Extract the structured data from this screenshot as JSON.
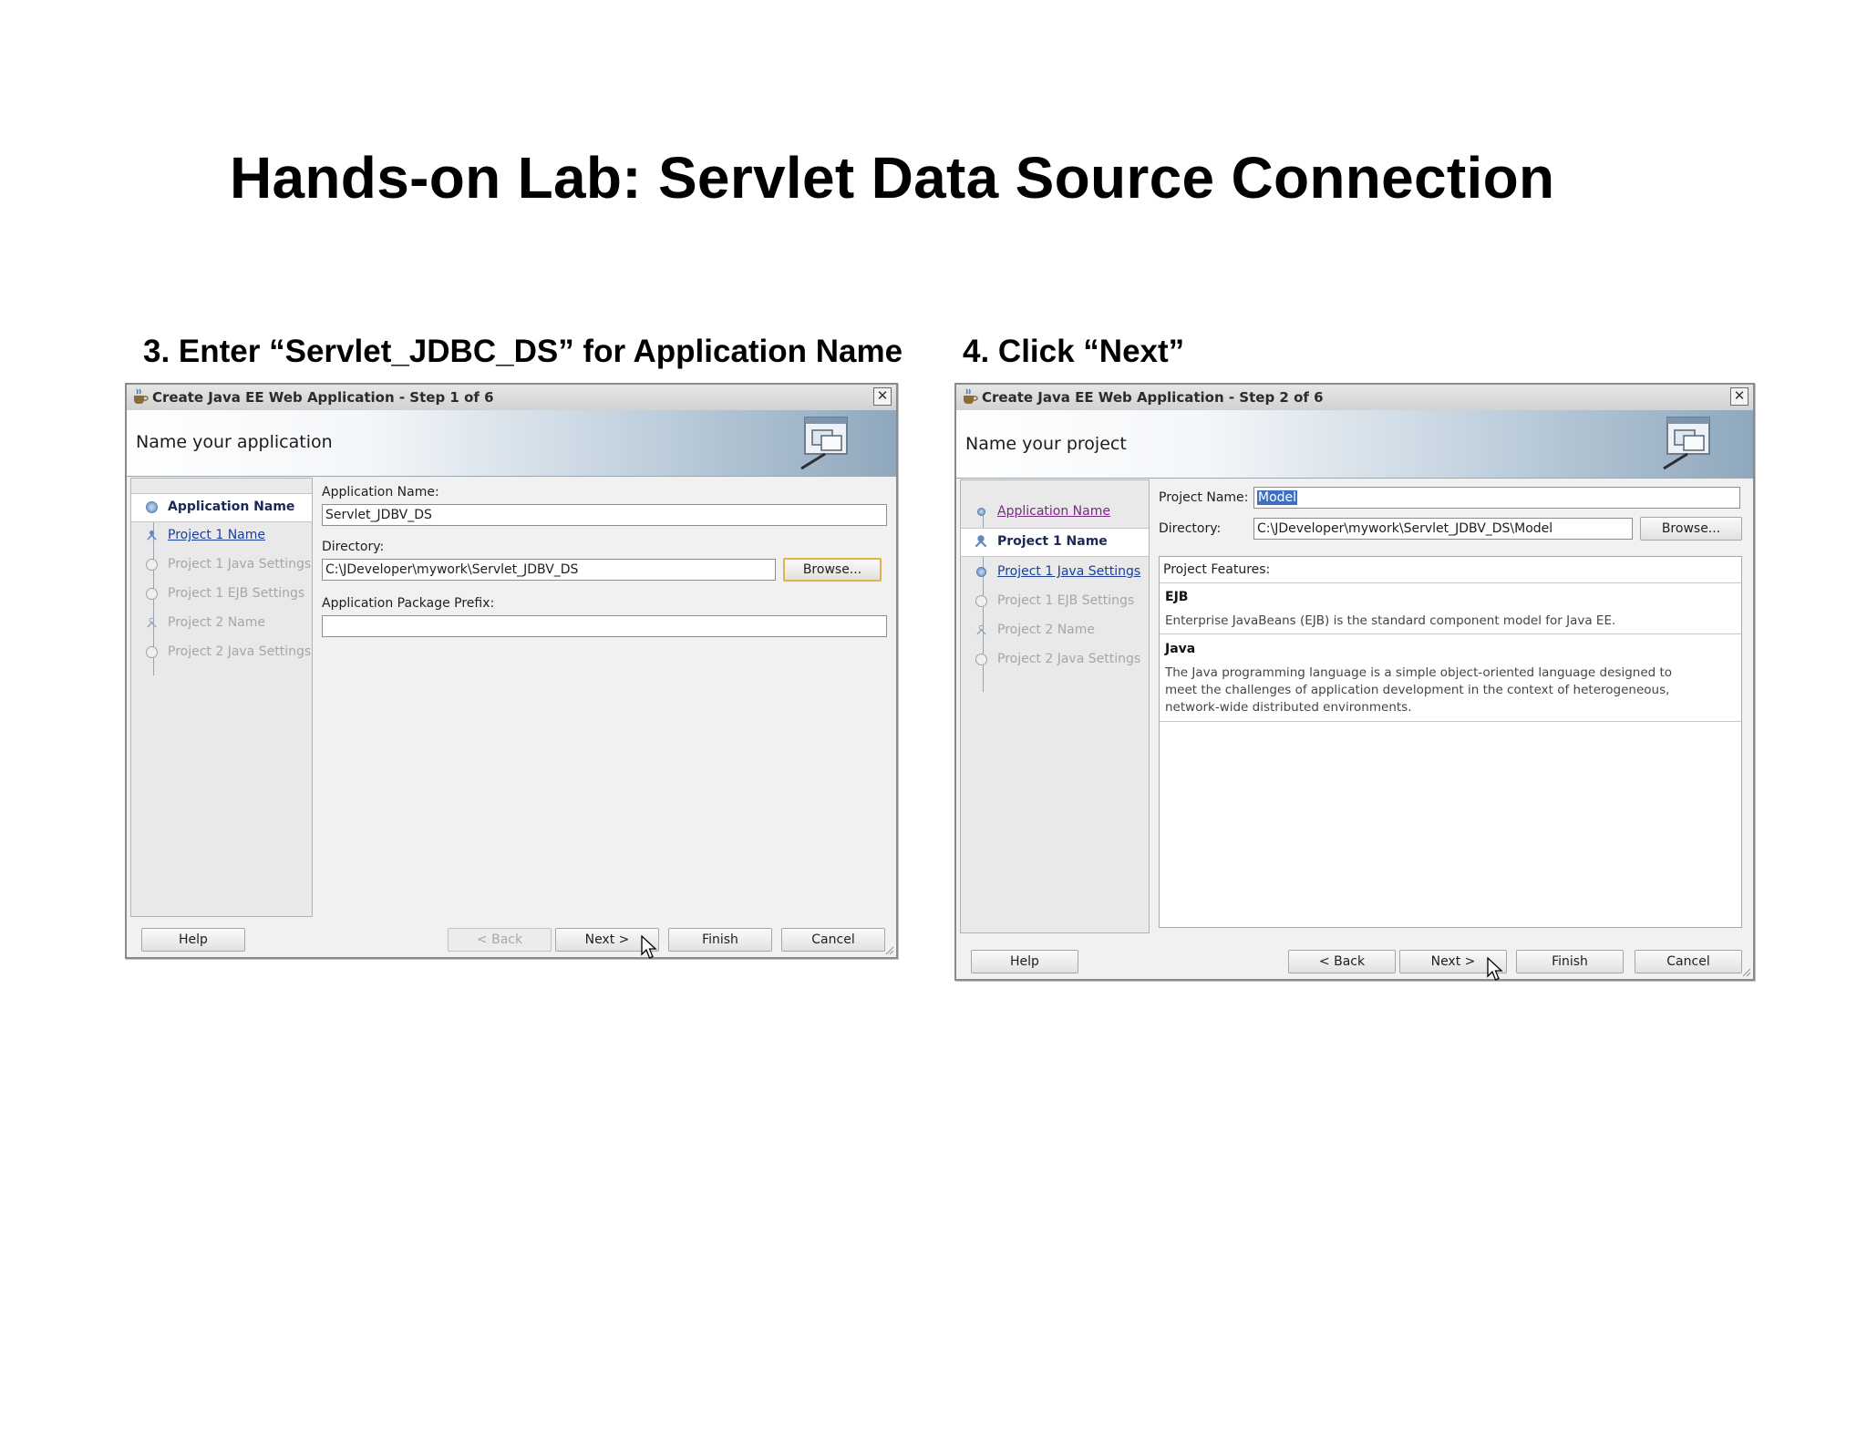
{
  "slide": {
    "title": "Hands-on Lab: Servlet Data Source Connection",
    "step3_caption": "3. Enter “Servlet_JDBC_DS” for Application Name",
    "step4_caption": "4. Click “Next”"
  },
  "dialog1": {
    "title": "Create Java EE Web Application - Step 1 of 6",
    "banner_title": "Name your application",
    "nav": [
      {
        "label": "Application Name",
        "state": "current"
      },
      {
        "label": "Project 1 Name",
        "state": "link"
      },
      {
        "label": "Project 1 Java Settings",
        "state": "disabled"
      },
      {
        "label": "Project 1 EJB Settings",
        "state": "disabled"
      },
      {
        "label": "Project 2 Name",
        "state": "disabled"
      },
      {
        "label": "Project 2 Java Settings",
        "state": "disabled"
      }
    ],
    "app_name_label": "Application Name:",
    "app_name_value": "Servlet_JDBV_DS",
    "directory_label": "Directory:",
    "directory_value": "C:\\JDeveloper\\mywork\\Servlet_JDBV_DS",
    "browse_label": "Browse...",
    "package_prefix_label": "Application Package Prefix:",
    "package_prefix_value": "",
    "buttons": {
      "help": "Help",
      "back": "< Back",
      "next": "Next >",
      "finish": "Finish",
      "cancel": "Cancel"
    }
  },
  "dialog2": {
    "title": "Create Java EE Web Application - Step 2 of 6",
    "banner_title": "Name your project",
    "nav": [
      {
        "label": "Application Name",
        "state": "visited"
      },
      {
        "label": "Project 1 Name",
        "state": "current"
      },
      {
        "label": "Project 1 Java Settings",
        "state": "link"
      },
      {
        "label": "Project 1 EJB Settings",
        "state": "disabled"
      },
      {
        "label": "Project 2 Name",
        "state": "disabled"
      },
      {
        "label": "Project 2 Java Settings",
        "state": "disabled"
      }
    ],
    "project_name_label": "Project Name:",
    "project_name_value": "Model",
    "directory_label": "Directory:",
    "directory_value": "C:\\JDeveloper\\mywork\\Servlet_JDBV_DS\\Model",
    "browse_label": "Browse...",
    "features_label": "Project Features:",
    "features": [
      {
        "name": "EJB",
        "description": "Enterprise JavaBeans (EJB) is the standard component model for Java EE."
      },
      {
        "name": "Java",
        "description": "The Java programming language is a simple object-oriented language designed to meet the challenges of application development in the context of heterogeneous, network-wide distributed environments."
      }
    ],
    "buttons": {
      "help": "Help",
      "back": "< Back",
      "next": "Next >",
      "finish": "Finish",
      "cancel": "Cancel"
    }
  }
}
